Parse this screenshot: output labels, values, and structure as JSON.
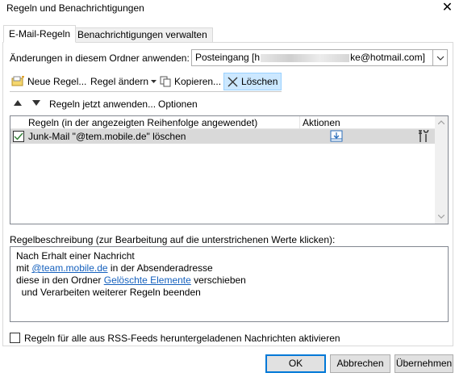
{
  "window": {
    "title": "Regeln und Benachrichtigungen",
    "close_glyph": "✕"
  },
  "tabs": [
    {
      "label": "E-Mail-Regeln",
      "active": true
    },
    {
      "label": "Benachrichtigungen verwalten",
      "active": false
    }
  ],
  "folder": {
    "label": "Änderungen in diesem Ordner anwenden:",
    "value_prefix": "Posteingang [h",
    "value_suffix": "ke@hotmail.com]"
  },
  "toolbar": {
    "new_rule": "Neue Regel...",
    "change_rule": "Regel ändern",
    "copy": "Kopieren...",
    "delete": "Löschen"
  },
  "toolbar2": {
    "run_rules": "Regeln jetzt anwenden...",
    "options": "Optionen"
  },
  "rules_table": {
    "columns": [
      "Regeln (in der angezeigten Reihenfolge angewendet)",
      "Aktionen"
    ],
    "rows": [
      {
        "name": "Junk-Mail \"@tem.mobile.de\" löschen",
        "checked": true
      }
    ]
  },
  "description": {
    "label": "Regelbeschreibung (zur Bearbeitung auf die unterstrichenen Werte klicken):",
    "line1": "Nach Erhalt einer Nachricht",
    "line2_pre": "mit ",
    "line2_link": "@team.mobile.de",
    "line2_post": " in der Absenderadresse",
    "line3_pre": "diese in den Ordner ",
    "line3_link": "Gelöschte Elemente",
    "line3_post": " verschieben",
    "line4": "  und Verarbeiten weiterer Regeln beenden"
  },
  "rss": {
    "label": "Regeln für alle aus RSS-Feeds heruntergeladenen Nachrichten aktivieren",
    "checked": false
  },
  "buttons": {
    "ok": "OK",
    "cancel": "Abbrechen",
    "apply": "Übernehmen"
  },
  "colors": {
    "link": "#1560bd",
    "selection": "#cce8ff",
    "row_highlight": "#d9d9d9",
    "accent": "#0078d7"
  }
}
